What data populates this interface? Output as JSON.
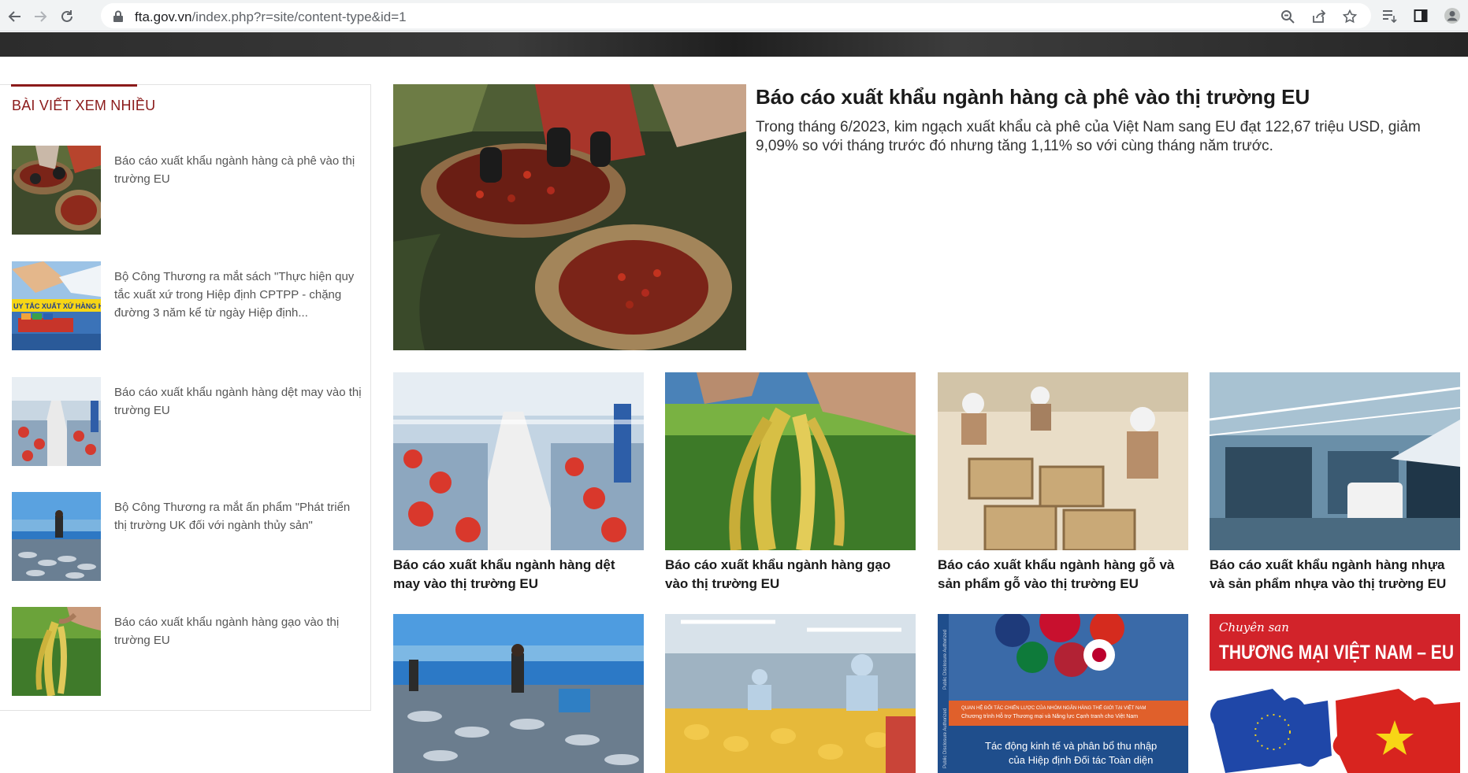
{
  "browser": {
    "url_domain": "fta.gov.vn",
    "url_path": "/index.php?r=site/content-type&id=1"
  },
  "sidebar": {
    "title": "BÀI VIẾT XEM NHIỀU",
    "items": [
      {
        "label": "Báo cáo xuất khẩu ngành hàng cà phê vào thị trường EU"
      },
      {
        "label": "Bộ Công Thương ra mắt sách \"Thực hiện quy tắc xuất xứ trong Hiệp định CPTPP - chặng đường 3 năm kể từ ngày Hiệp định...",
        "thumb_text": "UY TẮC XUẤT XỨ HÀNG HÓ"
      },
      {
        "label": "Báo cáo xuất khẩu ngành hàng dệt may vào thị trường EU"
      },
      {
        "label": "Bộ Công Thương ra mắt ấn phẩm \"Phát triển thị trường UK đối với ngành thủy sản\""
      },
      {
        "label": "Báo cáo xuất khẩu ngành hàng gạo vào thị trường EU"
      }
    ]
  },
  "featured": {
    "title": "Báo cáo xuất khẩu ngành hàng cà phê vào thị trường EU",
    "summary": "Trong tháng 6/2023, kim ngạch xuất khẩu cà phê của Việt Nam sang EU đạt 122,67 triệu USD, giảm 9,09% so với tháng trước đó nhưng tăng 1,11% so với cùng tháng năm trước."
  },
  "grid": [
    {
      "title": "Báo cáo xuất khẩu ngành hàng dệt may vào thị trường EU"
    },
    {
      "title": "Báo cáo xuất khẩu ngành hàng gạo vào thị trường EU"
    },
    {
      "title": "Báo cáo xuất khẩu ngành hàng gỗ và sản phẩm gỗ vào thị trường EU"
    },
    {
      "title": "Báo cáo xuất khẩu ngành hàng nhựa và sản phẩm nhựa vào thị trường EU"
    }
  ],
  "bottom_row": {
    "cover3": {
      "side_text": "Public Disclosure Authorized",
      "side_text2": "Public Disclosure Authorized",
      "banner_line1": "QUAN HỆ ĐỐI TÁC CHIẾN LƯỢC CỦA NHÓM NGÂN HÀNG THẾ GIỚI TẠI VIỆT NAM",
      "banner_line2": "Chương trình Hỗ trợ Thương mại và Năng lực Cạnh tranh cho Việt Nam",
      "title_line1": "Tác động kinh tế và phân bổ thu nhập",
      "title_line2": "của Hiệp định Đối tác Toàn diện"
    },
    "cover4": {
      "script_text": "Chuyên san",
      "headline": "THƯƠNG MẠI VIỆT NAM – EU"
    }
  },
  "colors": {
    "accent": "#8b1a1a",
    "strip": "#2c2c2c",
    "card_title": "#1a1a1a"
  }
}
